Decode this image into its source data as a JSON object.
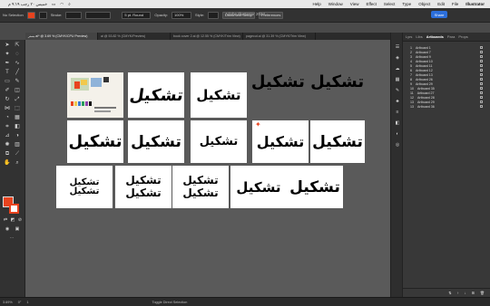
{
  "menubar": {
    "status_left": "خميس ٢٠ رجب ٩:١٩ م",
    "menus": [
      "Help",
      "Window",
      "View",
      "Effect",
      "Select",
      "Type",
      "Object",
      "Edit",
      "File",
      "Illustrator"
    ]
  },
  "controlbar": {
    "selection": "No Selection",
    "stroke_label": "Stroke:",
    "brush": "5 pt. Round",
    "opacity_label": "Opacity:",
    "opacity": "100%",
    "style_label": "Style:",
    "doc_setup": "Document Setup",
    "preferences": "Preferences",
    "app_title": "Adobe Illustrator 2024",
    "share": "Share"
  },
  "tabs": [
    {
      "label": "بستر.ai* @ 3.69 % (CMYK/CPU Preview)"
    },
    {
      "label": "ai @ 53.82 % (CMYK/Preview)"
    },
    {
      "label": "book cover 2.ai @ 12.55 % (CMYK/Trim View)"
    },
    {
      "label": "pagecut.ai @ 31.39 % (CMYK/Trim View)"
    }
  ],
  "artboards_panel": {
    "tabs": [
      "Lyrs",
      "Libs",
      "Artboards",
      "Para",
      "Props"
    ],
    "items": [
      {
        "n": "1",
        "name": "Artboard 1"
      },
      {
        "n": "2",
        "name": "Artboard 7"
      },
      {
        "n": "3",
        "name": "Artboard 9"
      },
      {
        "n": "4",
        "name": "Artboard 10"
      },
      {
        "n": "5",
        "name": "Artboard 11"
      },
      {
        "n": "6",
        "name": "Artboard 12"
      },
      {
        "n": "7",
        "name": "Artboard 13"
      },
      {
        "n": "8",
        "name": "Artboard 26"
      },
      {
        "n": "9",
        "name": "Artboard 29"
      },
      {
        "n": "10",
        "name": "Artboard 35"
      },
      {
        "n": "11",
        "name": "Artboard 27"
      },
      {
        "n": "12",
        "name": "Artboard 28"
      },
      {
        "n": "13",
        "name": "Artboard 29"
      },
      {
        "n": "13",
        "name": "Artboard 36"
      }
    ]
  },
  "artwork": {
    "word": "تشكيل",
    "banner": "تشكيل تشكيل"
  },
  "statusbar": {
    "zoom": "3.69%",
    "angle": "0°",
    "page": "1",
    "mode": "Toggle Direct Selection"
  },
  "colors": {
    "accent": "#e8431e",
    "share": "#2c6fdb"
  }
}
